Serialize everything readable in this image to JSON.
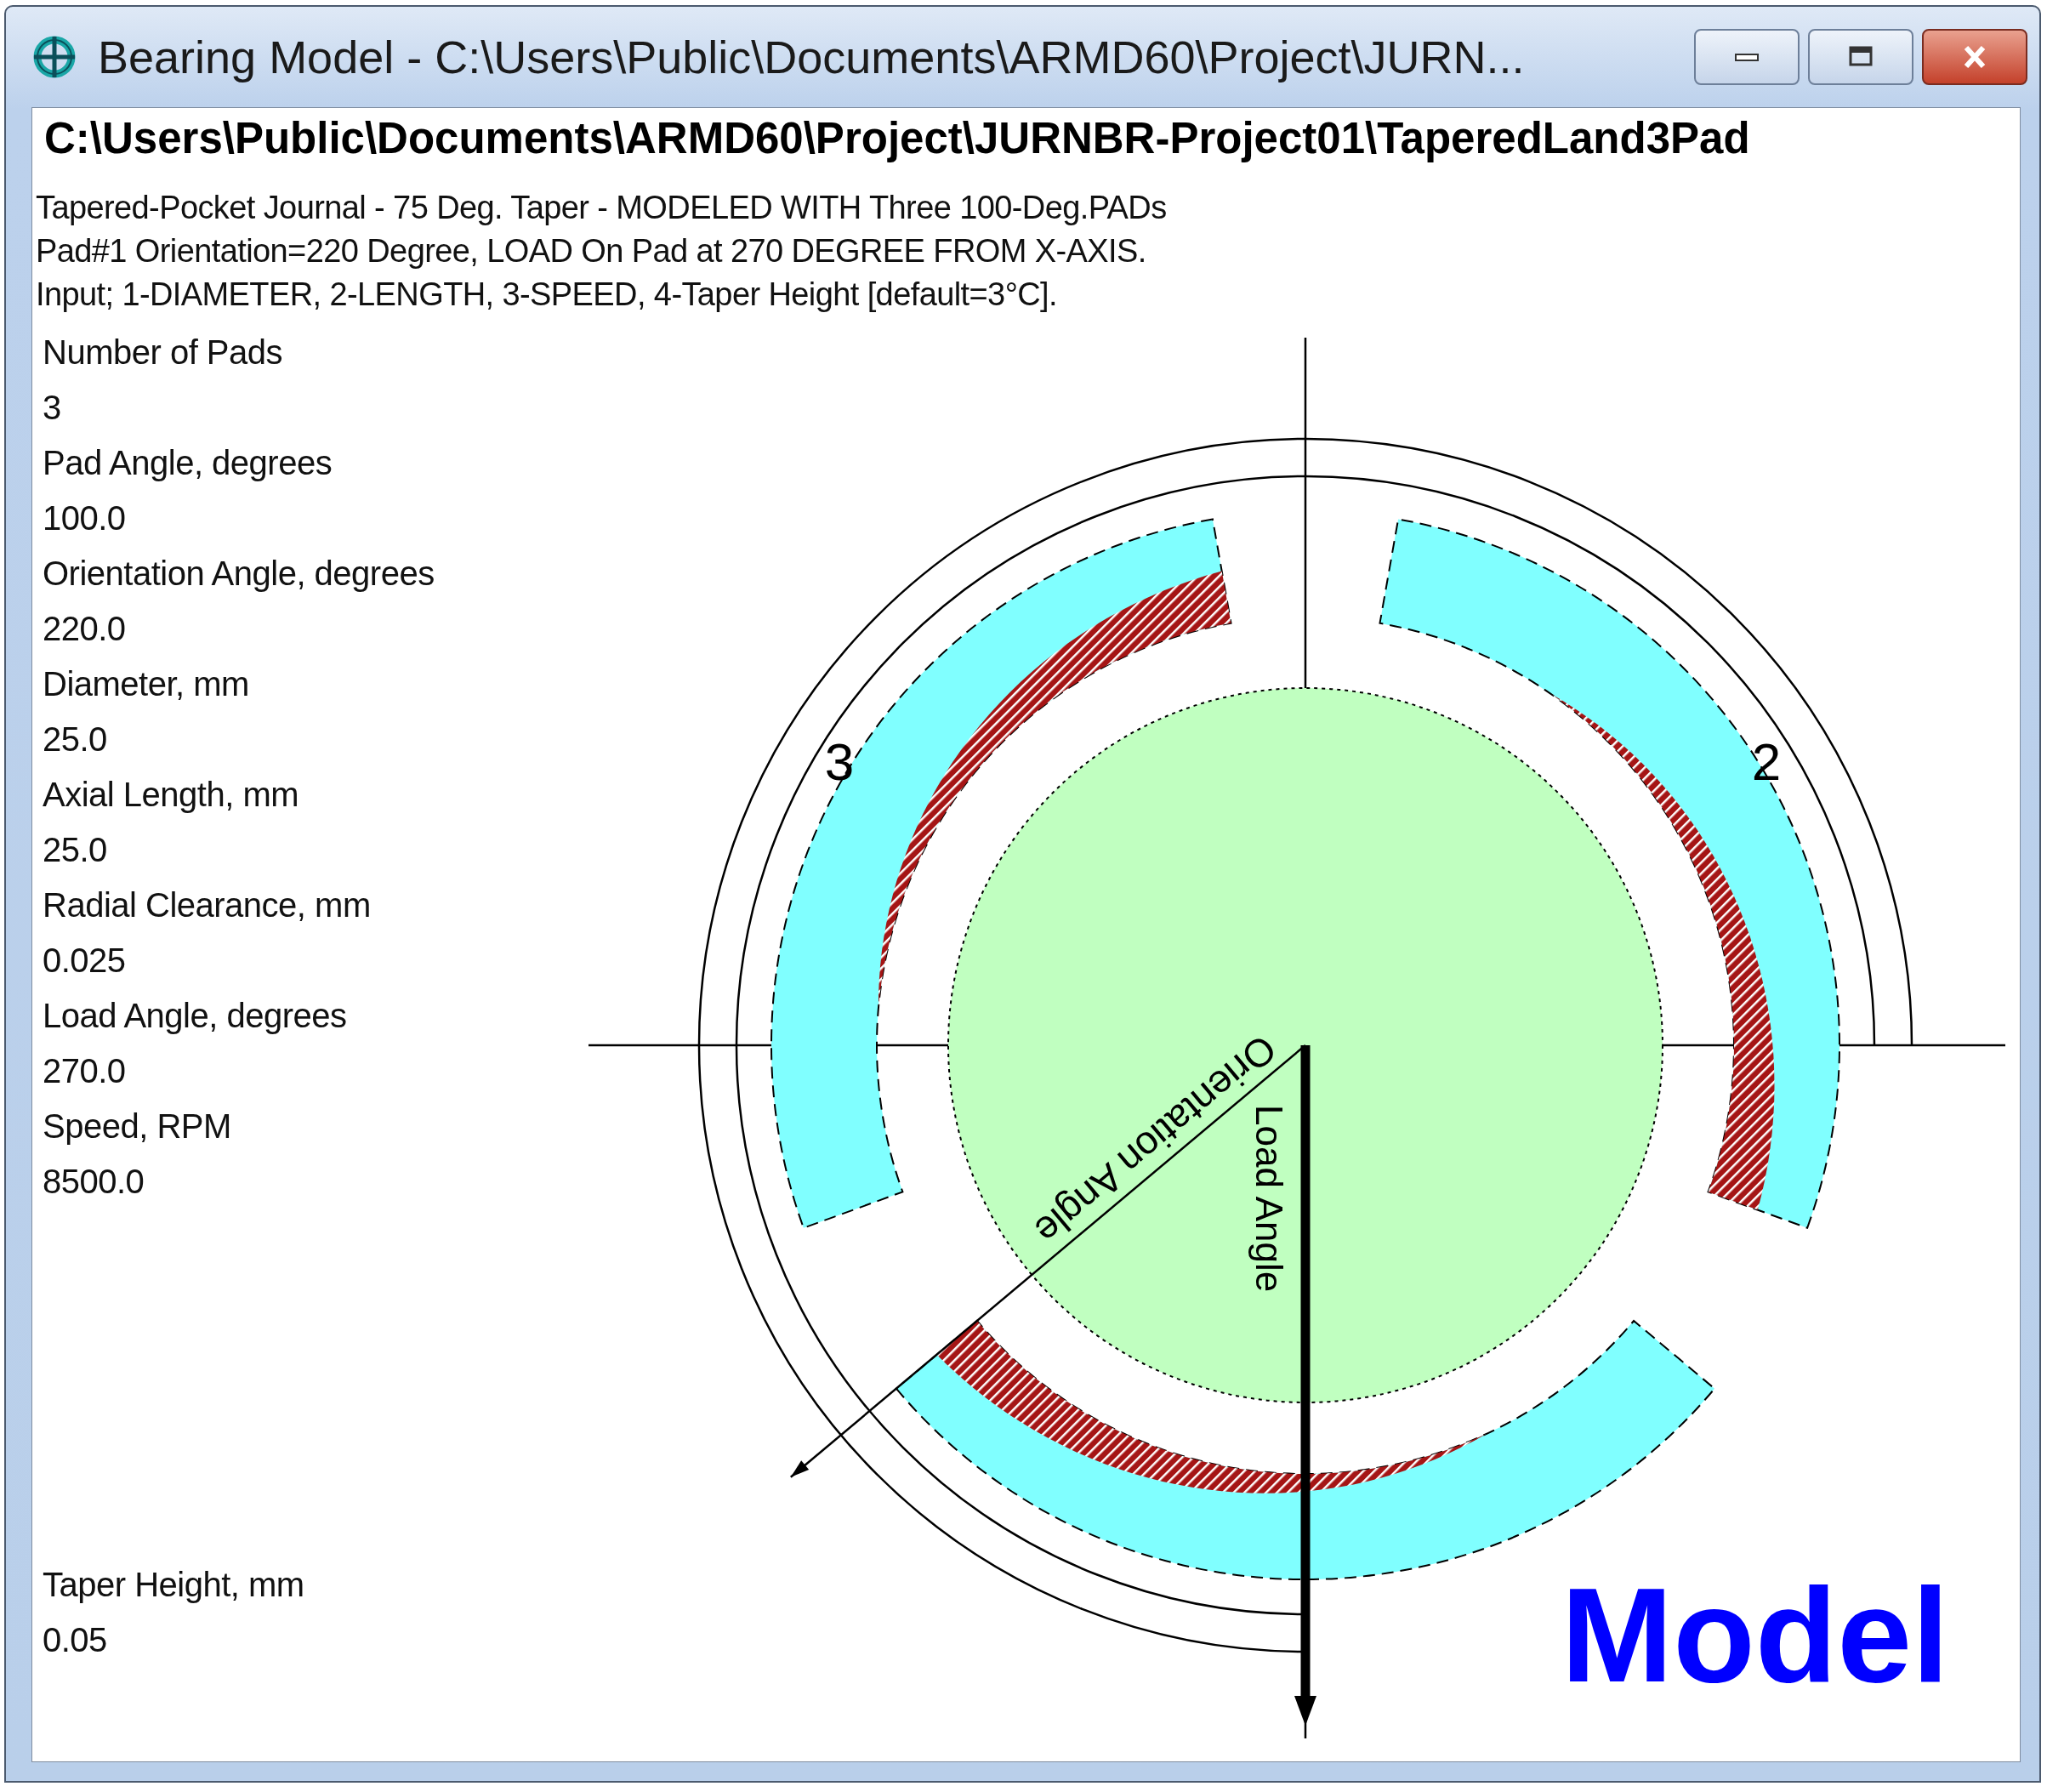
{
  "window": {
    "title": "Bearing Model - C:\\Users\\Public\\Documents\\ARMD60\\Project\\JURN..."
  },
  "file_path": "C:\\Users\\Public\\Documents\\ARMD60\\Project\\JURNBR-Project01\\TaperedLand3Pad",
  "description_lines": [
    "Tapered-Pocket Journal - 75 Deg. Taper - MODELED WITH Three 100-Deg.PADs",
    "Pad#1 Orientation=220 Degree, LOAD On Pad at 270 DEGREE FROM X-AXIS.",
    "Input; 1-DIAMETER, 2-LENGTH, 3-SPEED, 4-Taper Height [default=3°C]."
  ],
  "parameters": [
    {
      "label": "Number of Pads",
      "value": "3"
    },
    {
      "label": "Pad Angle, degrees",
      "value": "100.0"
    },
    {
      "label": "Orientation Angle, degrees",
      "value": "220.0"
    },
    {
      "label": "Diameter, mm",
      "value": "25.0"
    },
    {
      "label": "Axial Length,  mm",
      "value": "25.0"
    },
    {
      "label": "Radial Clearance,  mm",
      "value": "0.025"
    },
    {
      "label": "Load Angle, degrees",
      "value": "270.0"
    },
    {
      "label": "Speed, RPM",
      "value": "8500.0"
    }
  ],
  "taper_height": {
    "label": "Taper Height, mm",
    "value": "0.05"
  },
  "diagram": {
    "pad_labels": [
      "3",
      "2"
    ],
    "orientation_label": "Orientation Angle",
    "load_label": "Load Angle",
    "overlay_label": "Model"
  }
}
